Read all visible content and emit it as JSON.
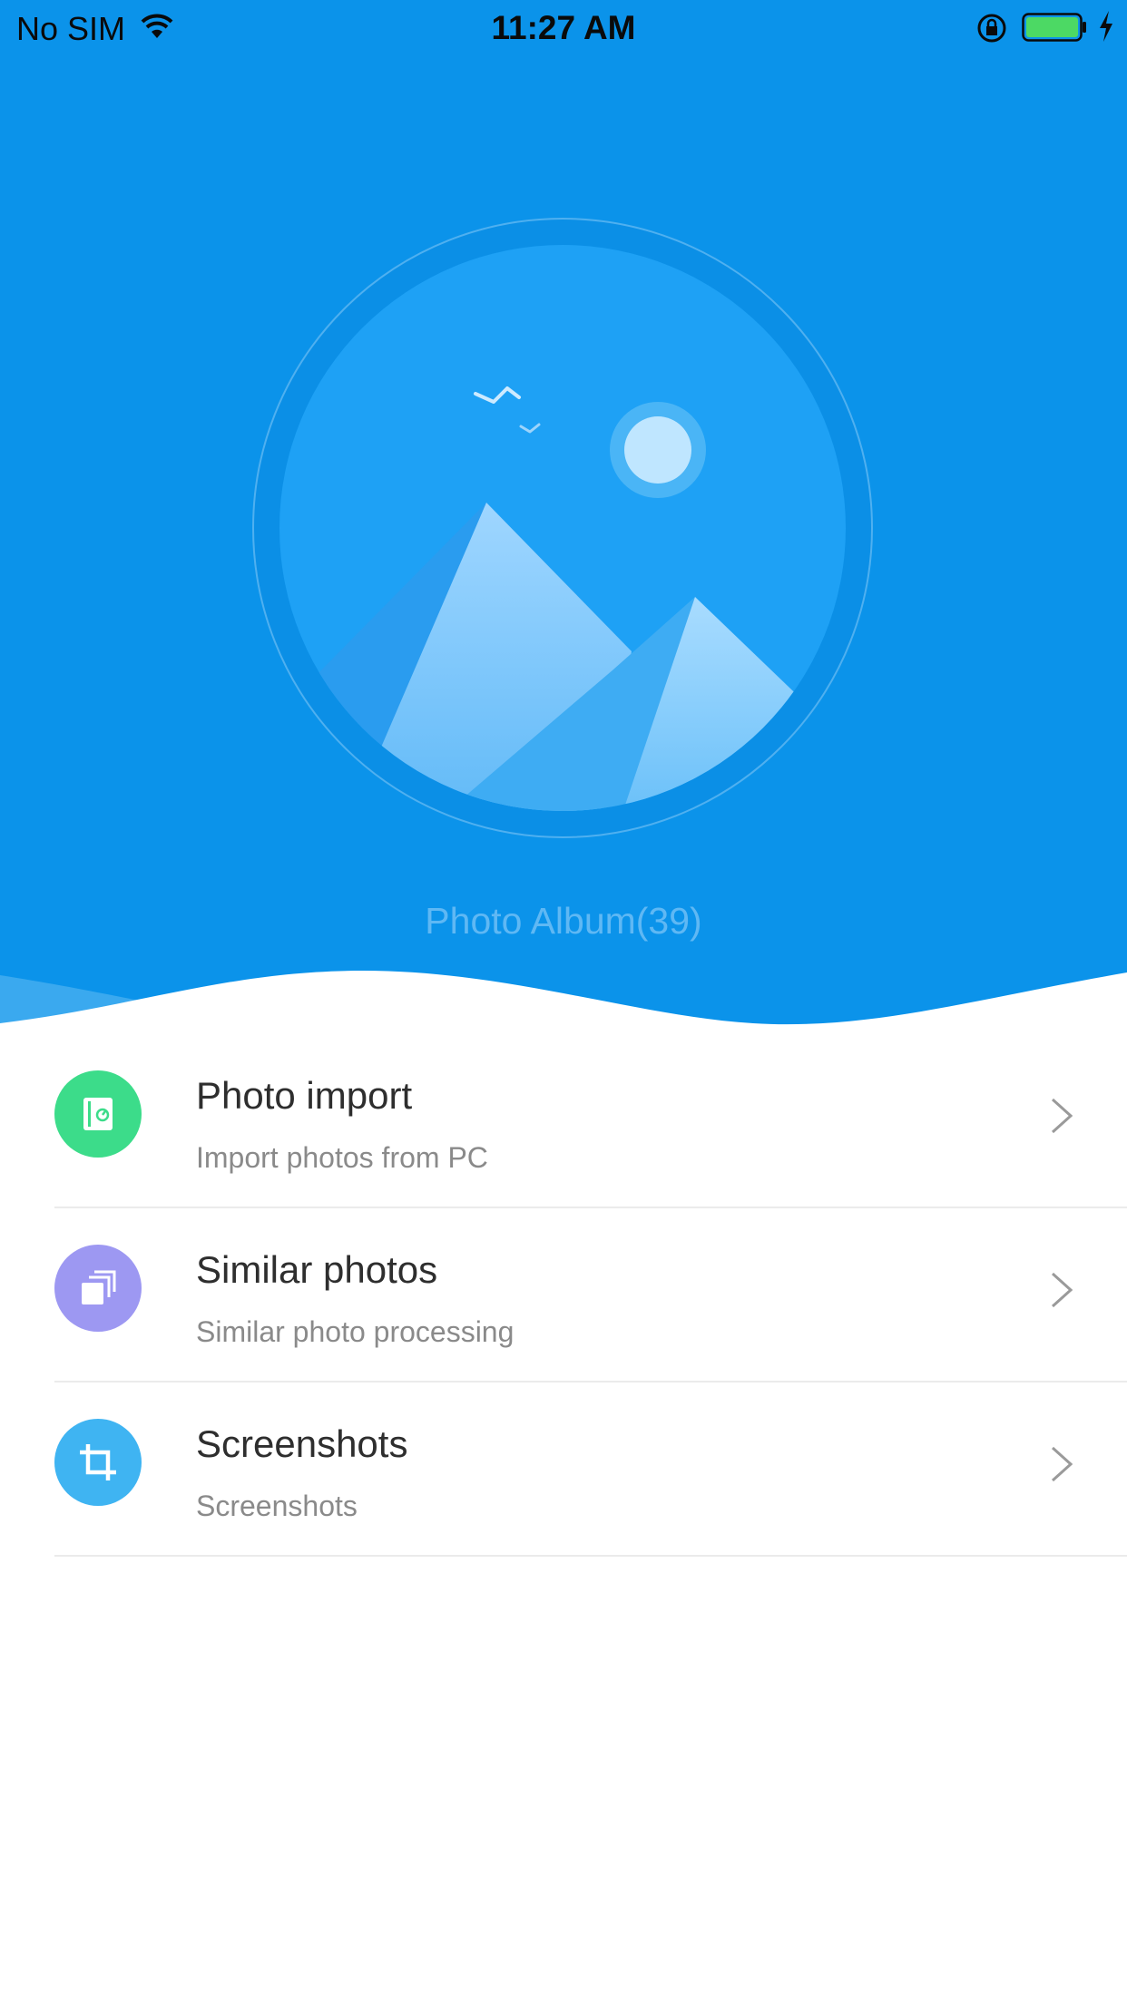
{
  "status_bar": {
    "carrier": "No SIM",
    "time": "11:27 AM",
    "icons": [
      "wifi-icon",
      "orientation-lock-icon",
      "battery-icon",
      "charging-bolt-icon"
    ],
    "battery_color": "#4cd964"
  },
  "header": {
    "background_color": "#0b93ea",
    "illustration": "photo-album-landscape-icon",
    "album_title": "Photo Album(39)"
  },
  "items": [
    {
      "title": "Photo import",
      "subtitle": "Import photos from PC",
      "icon": "import-icon",
      "icon_color": "#3cdc8a"
    },
    {
      "title": "Similar photos",
      "subtitle": "Similar photo processing",
      "icon": "stacked-photos-icon",
      "icon_color": "#9d98f2"
    },
    {
      "title": "Screenshots",
      "subtitle": "Screenshots",
      "icon": "crop-icon",
      "icon_color": "#3fb4f2"
    }
  ]
}
